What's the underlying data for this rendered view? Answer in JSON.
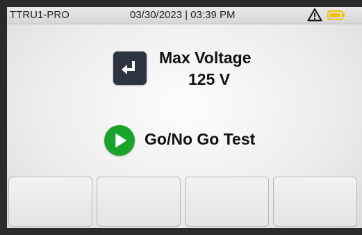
{
  "status_bar": {
    "device_name": "TTRU1-PRO",
    "datetime": "03/30/2023 | 03:39 PM",
    "warning_icon": "warning-triangle-icon",
    "battery_icon": "battery-icon",
    "battery_color": "#f2c200"
  },
  "setting": {
    "label": "Max Voltage",
    "value": "125 V",
    "icon": "enter-icon"
  },
  "test": {
    "label": "Go/No Go Test",
    "icon": "play-icon",
    "color": "#1aa32a"
  },
  "softkeys": [
    {
      "label": ""
    },
    {
      "label": ""
    },
    {
      "label": ""
    },
    {
      "label": ""
    }
  ]
}
